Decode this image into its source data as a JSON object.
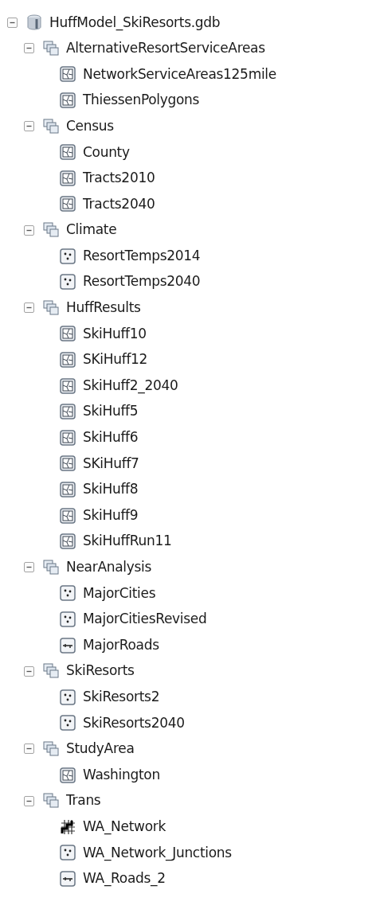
{
  "tree": [
    {
      "label": "HuffModel_SkiResorts.gdb",
      "kind": "database",
      "expanded": true,
      "children": [
        {
          "label": "AlternativeResortServiceAreas",
          "kind": "dataset",
          "expanded": true,
          "children": [
            {
              "label": "NetworkServiceAreas125mile",
              "kind": "polygon"
            },
            {
              "label": "ThiessenPolygons",
              "kind": "polygon"
            }
          ]
        },
        {
          "label": "Census",
          "kind": "dataset",
          "expanded": true,
          "children": [
            {
              "label": "County",
              "kind": "polygon"
            },
            {
              "label": "Tracts2010",
              "kind": "polygon"
            },
            {
              "label": "Tracts2040",
              "kind": "polygon"
            }
          ]
        },
        {
          "label": "Climate",
          "kind": "dataset",
          "expanded": true,
          "children": [
            {
              "label": "ResortTemps2014",
              "kind": "point"
            },
            {
              "label": "ResortTemps2040",
              "kind": "point"
            }
          ]
        },
        {
          "label": "HuffResults",
          "kind": "dataset",
          "expanded": true,
          "children": [
            {
              "label": "SkiHuff10",
              "kind": "polygon"
            },
            {
              "label": "SKiHuff12",
              "kind": "polygon"
            },
            {
              "label": "SkiHuff2_2040",
              "kind": "polygon"
            },
            {
              "label": "SkiHuff5",
              "kind": "polygon"
            },
            {
              "label": "SkiHuff6",
              "kind": "polygon"
            },
            {
              "label": "SKiHuff7",
              "kind": "polygon"
            },
            {
              "label": "SkiHuff8",
              "kind": "polygon"
            },
            {
              "label": "SkiHuff9",
              "kind": "polygon"
            },
            {
              "label": "SkiHuffRun11",
              "kind": "polygon"
            }
          ]
        },
        {
          "label": "NearAnalysis",
          "kind": "dataset",
          "expanded": true,
          "children": [
            {
              "label": "MajorCities",
              "kind": "point"
            },
            {
              "label": "MajorCitiesRevised",
              "kind": "point"
            },
            {
              "label": "MajorRoads",
              "kind": "line"
            }
          ]
        },
        {
          "label": "SkiResorts",
          "kind": "dataset",
          "expanded": true,
          "children": [
            {
              "label": "SkiResorts2",
              "kind": "point"
            },
            {
              "label": "SkiResorts2040",
              "kind": "point"
            }
          ]
        },
        {
          "label": "StudyArea",
          "kind": "dataset",
          "expanded": true,
          "children": [
            {
              "label": "Washington",
              "kind": "polygon"
            }
          ]
        },
        {
          "label": "Trans",
          "kind": "dataset",
          "expanded": true,
          "children": [
            {
              "label": "WA_Network",
              "kind": "network"
            },
            {
              "label": "WA_Network_Junctions",
              "kind": "point"
            },
            {
              "label": "WA_Roads_2",
              "kind": "line"
            }
          ]
        }
      ]
    }
  ]
}
